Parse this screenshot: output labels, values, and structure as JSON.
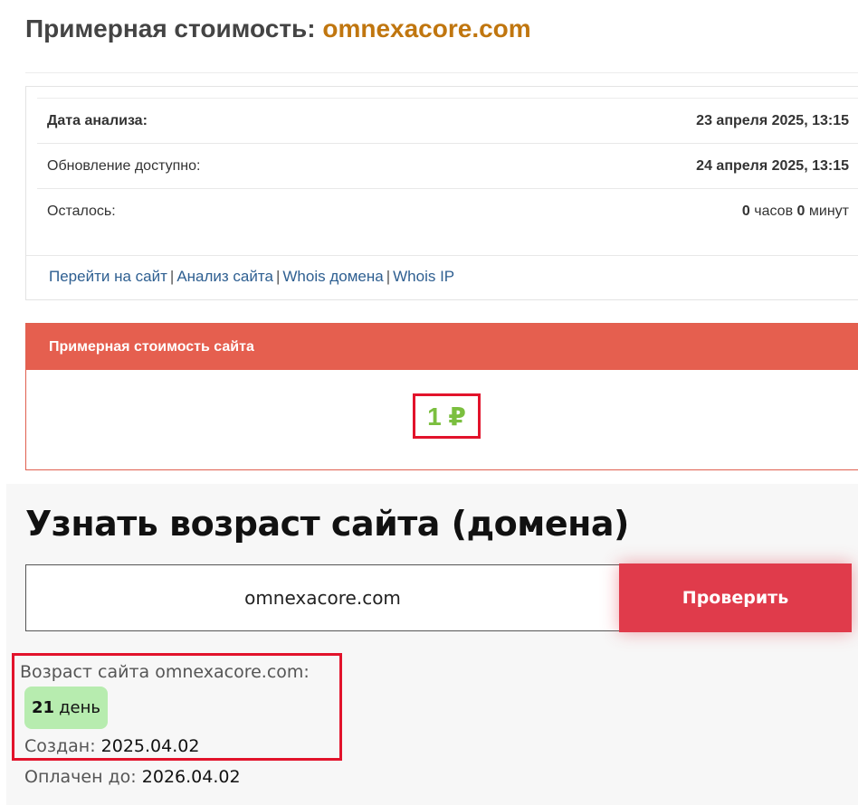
{
  "header": {
    "title_prefix": "Примерная стоимость:",
    "domain": "omnexacore.com"
  },
  "info": {
    "rows": [
      {
        "label": "Дата анализа:",
        "value": "23 апреля 2025, 13:15"
      },
      {
        "label": "Обновление доступно:",
        "value": "24 апреля 2025, 13:15"
      },
      {
        "label": "Осталось:",
        "hours_num": "0",
        "hours_unit": "часов",
        "minutes_num": "0",
        "minutes_unit": "минут"
      }
    ],
    "links": [
      "Перейти на сайт",
      "Анализ сайта",
      "Whois домена",
      "Whois IP"
    ],
    "link_separator": "|"
  },
  "price": {
    "header": "Примерная стоимость сайта",
    "value": "1 ₽"
  },
  "age": {
    "title": "Узнать возраст сайта (домена)",
    "input_value": "omnexacore.com",
    "button_label": "Проверить",
    "result_label": "Возраст сайта omnexacore.com:",
    "age_number": "21",
    "age_unit": "день",
    "created_label": "Создан:",
    "created_value": "2025.04.02",
    "paid_label": "Оплачен до:",
    "paid_value": "2026.04.02"
  },
  "colors": {
    "domain_accent": "#c0760f",
    "link": "#2e5f91",
    "price_header_bg": "#e55f4f",
    "price_value": "#7bbf3f",
    "highlight_border": "#e2132b",
    "check_button_bg": "#e03b4b",
    "age_badge_bg": "#b7ecaf"
  }
}
